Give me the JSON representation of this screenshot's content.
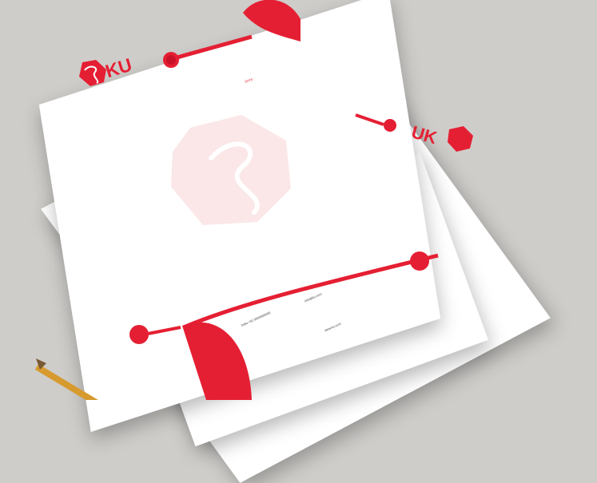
{
  "brand": {
    "name": "KU"
  },
  "date_label": "DATE :",
  "contact": {
    "phone": "India +91 9000000000",
    "email": "info@ku.com",
    "website": "www.ku.com"
  },
  "colors": {
    "accent": "#e51f33",
    "paper": "#ffffff",
    "background": "#cfcdca",
    "pencil": "#d79a2f"
  }
}
